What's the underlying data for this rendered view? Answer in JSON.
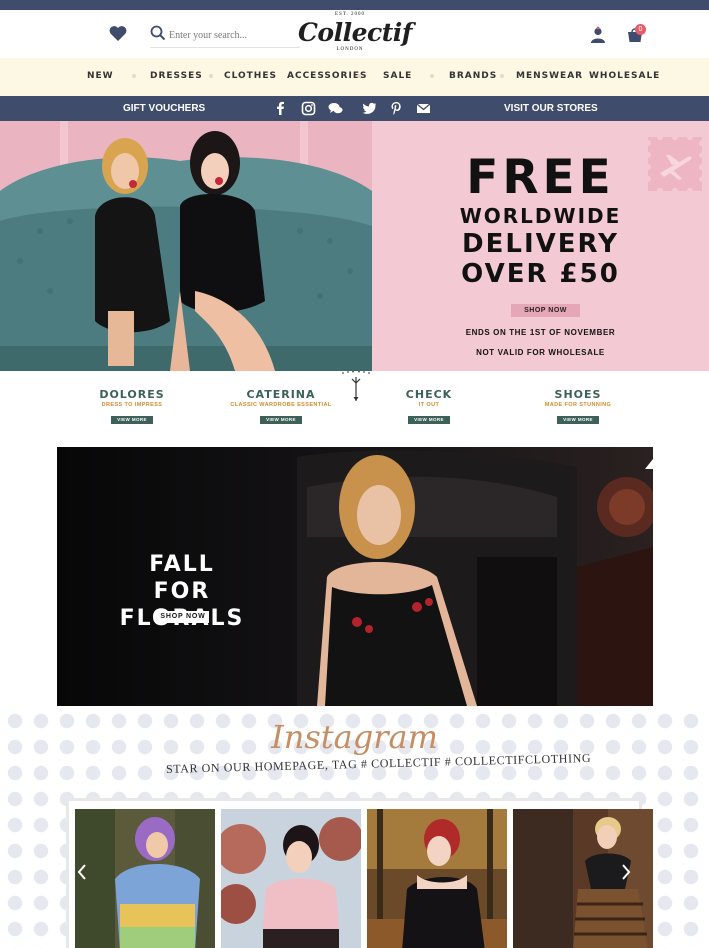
{
  "header": {
    "search_placeholder": "Enter your search...",
    "logo": {
      "est": "EST. 2000",
      "name": "Collectif",
      "city": "LONDON"
    },
    "cart_count": "0",
    "icons": [
      "heart-icon",
      "search-icon",
      "account-icon",
      "cart-icon"
    ]
  },
  "nav": {
    "items": [
      {
        "label": "NEW"
      },
      {
        "label": "DRESSES"
      },
      {
        "label": "CLOTHES"
      },
      {
        "label": "ACCESSORIES"
      },
      {
        "label": "SALE"
      },
      {
        "label": "BRANDS"
      },
      {
        "label": "MENSWEAR"
      },
      {
        "label": "WHOLESALE"
      }
    ]
  },
  "subbar": {
    "gift_vouchers": "GIFT VOUCHERS",
    "visit_stores": "VISIT OUR STORES",
    "social_icons": [
      "facebook-icon",
      "instagram-icon",
      "chat-icon",
      "twitter-icon",
      "pinterest-icon",
      "email-icon"
    ]
  },
  "hero": {
    "line1": "FREE",
    "line2": "WORLDWIDE",
    "line3": "DELIVERY",
    "line4": "OVER £50",
    "button": "SHOP NOW",
    "note1": "ENDS ON THE 1ST OF NOVEMBER",
    "note2": "NOT VALID FOR WHOLESALE"
  },
  "categories": [
    {
      "title": "DOLORES",
      "subtitle": "DRESS TO IMPRESS",
      "button": "VIEW MORE"
    },
    {
      "title": "CATERINA",
      "subtitle": "CLASSIC WARDROBE ESSENTIAL",
      "button": "VIEW MORE"
    },
    {
      "title": "CHECK",
      "subtitle": "IT OUT",
      "button": "VIEW MORE"
    },
    {
      "title": "SHOES",
      "subtitle": "MADE FOR STUNNING",
      "button": "VIEW MORE"
    }
  ],
  "banner": {
    "title": "FALL FOR\nFLORALS",
    "button": "SHOP NOW"
  },
  "instagram": {
    "title": "Instagram",
    "tagline": "STAR ON OUR HOMEPAGE, TAG  # COLLECTIF  # COLLECTIFCLOTHING"
  },
  "colors": {
    "navy": "#3f4c6b",
    "cream": "#fdf8e4",
    "pink": "#f3c9d3",
    "teal": "#3d6058",
    "orange": "#d9892e",
    "cart_badge": "#e45d6a"
  }
}
